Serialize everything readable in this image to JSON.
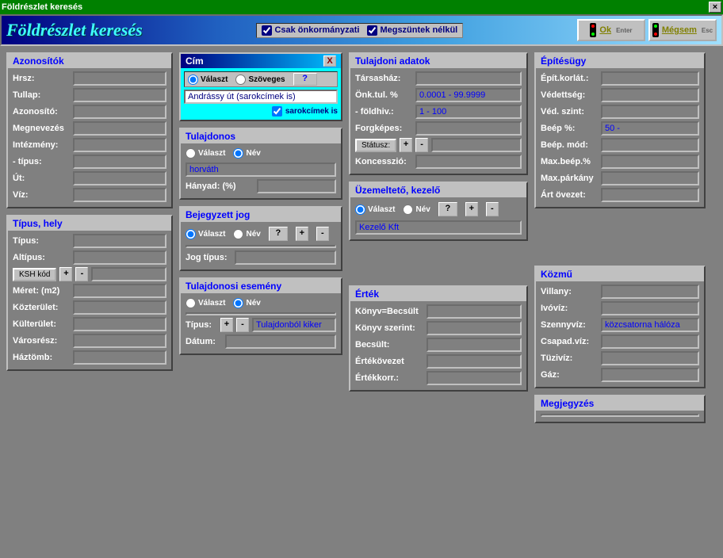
{
  "window": {
    "title": "Földrészlet keresés"
  },
  "header": {
    "title": "Földrészlet keresés",
    "chk_onkormanyzati": "Csak önkormányzati",
    "chk_megszuntek": "Megszüntek nélkül",
    "ok_label": "Ok",
    "ok_hint": "Enter",
    "cancel_label": "Mégsem",
    "cancel_hint": "Esc"
  },
  "azonositok": {
    "title": "Azonosítók",
    "hrsz": "Hrsz:",
    "tullap": "Tullap:",
    "azonosito": "Azonosító:",
    "megnevezes": "Megnevezés",
    "intezmeny": "Intézmény:",
    "tipus": "   - típus:",
    "ut": "Út:",
    "viz": "Víz:"
  },
  "cim": {
    "title": "Cím",
    "valaszt": "Választ",
    "szoveges": "Szöveges",
    "help": "?",
    "value": "Andrássy út (sarokcímek is)",
    "sarokcimek": "sarokcímek is"
  },
  "tulajdonos": {
    "title": "Tulajdonos",
    "valaszt": "Választ",
    "nev": "Név",
    "value": "horváth",
    "hanyad": "Hányad: (%)"
  },
  "bejegyzett": {
    "title": "Bejegyzett jog",
    "valaszt": "Választ",
    "nev": "Név",
    "jogtipus": "Jog típus:"
  },
  "tulesemeny": {
    "title": "Tulajdonosi esemény",
    "valaszt": "Választ",
    "nev": "Név",
    "tipus": "Típus:",
    "tipus_value": "Tulajdonból kiker",
    "datum": "Dátum:"
  },
  "tipushely": {
    "title": "Típus, hely",
    "tipus": "Típus:",
    "altipus": "Altípus:",
    "kshkod": "KSH kód",
    "meret": "Méret: (m2)",
    "kozterulet": "Közterület:",
    "kulterulet": "Külterület:",
    "varosresz": "Városrész:",
    "haztomb": "Háztömb:"
  },
  "tulajdoni": {
    "title": "Tulajdoni adatok",
    "tarsashaz": "Társasház:",
    "onktul": "Önk.tul. %",
    "onktul_value": "0.0001 - 99.9999",
    "foldhiv": "  - földhiv.:",
    "foldhiv_value": "1 - 100",
    "forgkepes": "Forgképes:",
    "statusz": "Státusz:",
    "koncesszio": "Koncesszió:"
  },
  "uzemelteto": {
    "title": "Üzemeltető, kezelő",
    "valaszt": "Választ",
    "nev": "Név",
    "value": "Kezelő Kft"
  },
  "ertek": {
    "title": "Érték",
    "konyvbecsult": "Könyv=Becsült",
    "konyvszerint": "Könyv szerint:",
    "becsult": "Becsült:",
    "ertekovezet": "Értékövezet",
    "ertekkorr": "Értékkorr.:"
  },
  "epitesugy": {
    "title": "Építésügy",
    "epitkorlat": "Épít.korlát.:",
    "vedettseg": "Védettség:",
    "vedszint": "Véd. szint:",
    "beep": "Beép %:",
    "beep_value": "50 -",
    "beepmod": "Beép. mód:",
    "maxbeep": "Max.beép.%",
    "maxparkany": "Max.párkány",
    "artovezet": "Árt övezet:"
  },
  "kozmu": {
    "title": "Közmű",
    "villany": "Villany:",
    "ivoviz": "Ivóvíz:",
    "szennyviz": "Szennyvíz:",
    "szennyviz_value": "közcsatorna hálóza",
    "csapadviz": "Csapad.víz:",
    "tuziviz": "Tüzivíz:",
    "gaz": "Gáz:"
  },
  "megjegyzes": {
    "title": "Megjegyzés"
  },
  "sym": {
    "plus": "+",
    "minus": "-",
    "q": "?"
  }
}
